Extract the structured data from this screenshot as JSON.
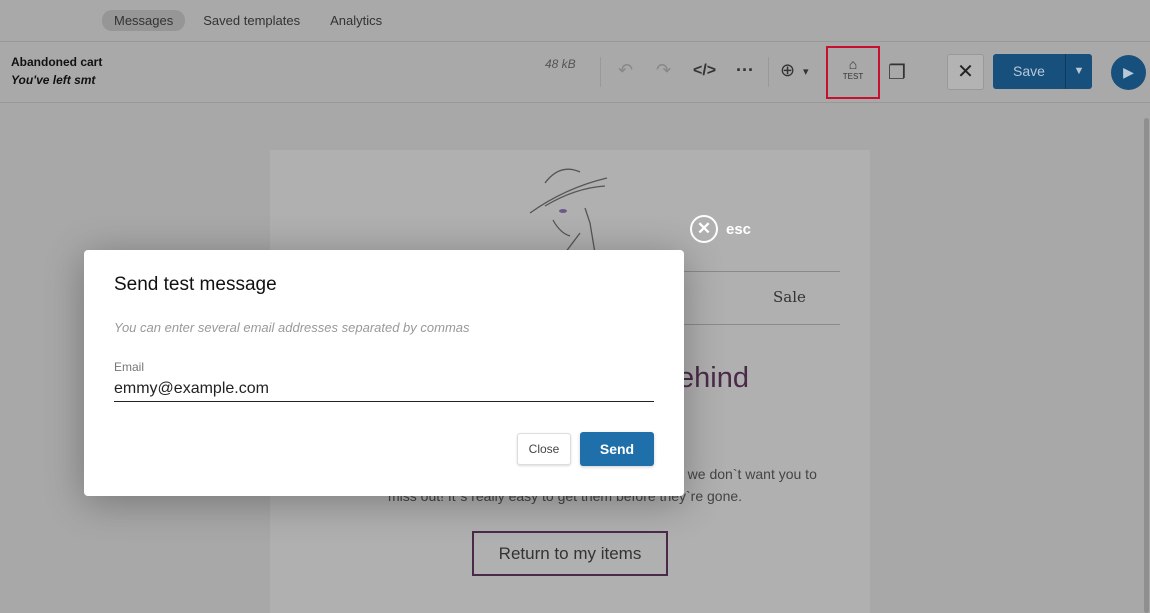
{
  "nav": {
    "tabs": [
      {
        "label": "Messages",
        "active": true
      },
      {
        "label": "Saved templates"
      },
      {
        "label": "Analytics"
      }
    ]
  },
  "toolbar": {
    "template_name": "Abandoned cart",
    "subject": "You've left smt",
    "size": "48 kB",
    "test_label": "TEST",
    "save_label": "Save",
    "highlight_color": "#c8102e"
  },
  "email": {
    "menu_item": "Sale",
    "headline_fragment": "ehind",
    "body_line1_fragment": "d we don`t want you to",
    "body_line2_fragment": "miss out! It`s really easy to get them before they`re gone.",
    "cta": "Return to my items"
  },
  "overlay": {
    "esc_label": "esc"
  },
  "modal": {
    "title": "Send test message",
    "hint": "You can enter several email addresses separated by commas",
    "email_label": "Email",
    "email_value": "emmy@example.com",
    "close_label": "Close",
    "send_label": "Send"
  }
}
